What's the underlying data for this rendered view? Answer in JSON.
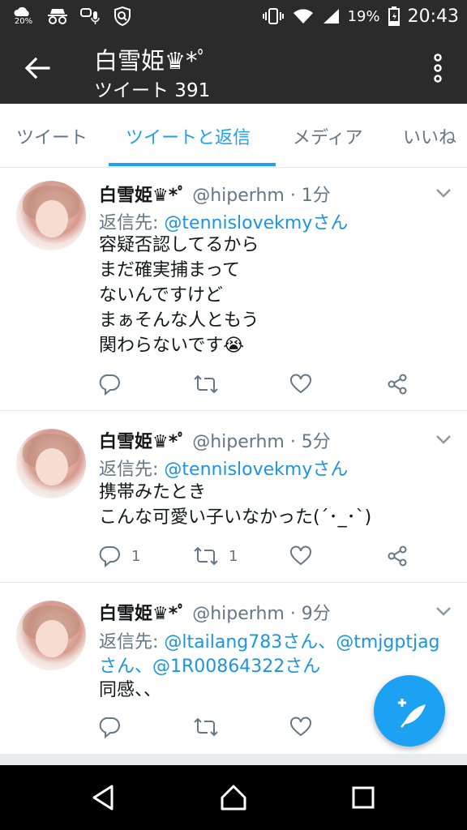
{
  "status_bar": {
    "weather_percent": "20%",
    "battery": "19%",
    "time": "20:43"
  },
  "header": {
    "title": "白雪姫♛*ﾟ",
    "subtitle": "ツイート 391"
  },
  "tabs": [
    "ツイート",
    "ツイートと返信",
    "メディア",
    "いいね"
  ],
  "active_tab": "ツイートと返信",
  "tweets": [
    {
      "name": "白雪姫♛*ﾟ",
      "handle": "@hiperhm · 1分",
      "reply_prefix": "返信先: ",
      "reply_to": "@tennislovekmyさん",
      "reply_to_line2": "",
      "body": "容疑否認してるから\nまだ確実捕まって\nないんですけど\nまぁそんな人ともう\n関わらないです😭",
      "reply_count": "",
      "retweet_count": ""
    },
    {
      "name": "白雪姫♛*ﾟ",
      "handle": "@hiperhm · 5分",
      "reply_prefix": "返信先: ",
      "reply_to": "@tennislovekmyさん",
      "reply_to_line2": "",
      "body": "携帯みたとき\nこんな可愛い子いなかった(´･_･`)",
      "reply_count": "1",
      "retweet_count": "1"
    },
    {
      "name": "白雪姫♛*ﾟ",
      "handle": "@hiperhm · 9分",
      "reply_prefix": "返信先: ",
      "reply_to": "@ltailang783さん、@tmjgptjag",
      "reply_to_line2": "さん、@1R00864322さん",
      "body": "同感、、",
      "reply_count": "",
      "retweet_count": ""
    }
  ],
  "icons": {
    "back": "arrow-left-icon",
    "more": "more-vertical-icon",
    "reply": "reply-icon",
    "retweet": "retweet-icon",
    "like": "heart-icon",
    "share": "share-icon",
    "compose": "compose-tweet-icon"
  },
  "colors": {
    "accent": "#1da1f2",
    "header_bg": "#2b2b2b",
    "secondary_text": "#657786"
  }
}
